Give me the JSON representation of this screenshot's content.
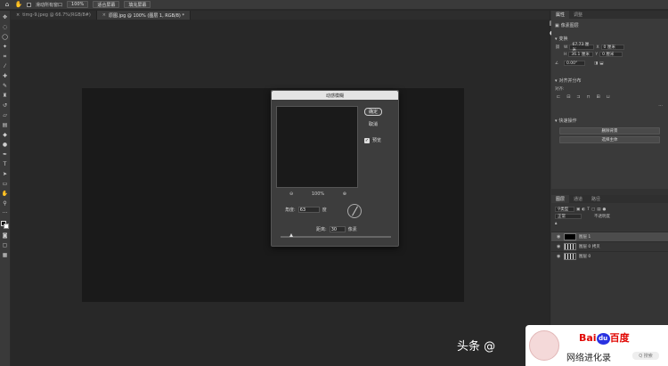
{
  "options_bar": {
    "auto_select_label": "滑动所有窗口",
    "zoom_value": "100%",
    "fit_screen_label": "适合屏幕",
    "fill_screen_label": "填充屏幕"
  },
  "tabs": [
    {
      "label": "timg-9.jpeg @ 66.7%(RGB/8#)",
      "active": false
    },
    {
      "label": "原图.jpg @ 100% (图层 1, RGB/8) *",
      "active": true
    }
  ],
  "properties_panel": {
    "tabs": [
      "属性",
      "调整"
    ],
    "pixel_layer_label": "像素图层",
    "transform_title": "变换",
    "w_label": "W",
    "w_value": "67.73 厘米",
    "x_label": "X",
    "x_value": "0 厘米",
    "h_label": "H",
    "h_value": "36.1 厘米",
    "y_label": "Y",
    "y_value": "0 厘米",
    "angle_value": "0.00°",
    "align_title": "对齐并分布",
    "align_label": "对齐:",
    "quick_actions_title": "快速操作",
    "remove_bg_label": "删除背景",
    "select_subject_label": "选择主体"
  },
  "layers_panel": {
    "tabs": [
      "图层",
      "通道",
      "路径"
    ],
    "kind_label": "类型",
    "mode_label": "正常",
    "opacity_label": "不透明度",
    "layers": [
      {
        "name": "图层 1",
        "selected": true
      },
      {
        "name": "图层 0 拷贝",
        "selected": false
      },
      {
        "name": "图层 0",
        "selected": false
      }
    ]
  },
  "motion_blur": {
    "title": "动感模糊",
    "ok_label": "确定",
    "cancel_label": "取消",
    "preview_label": "预览",
    "zoom_out": "−",
    "zoom_value": "100%",
    "zoom_in": "+",
    "angle_label": "角度:",
    "angle_value": "63",
    "angle_unit": "度",
    "distance_label": "距离:",
    "distance_value": "30",
    "distance_unit": "像素"
  },
  "watermark": {
    "source_text": "头条 @",
    "baidu_logo_text": "Bai",
    "baidu_du": "du",
    "baidu_cn": "百度",
    "account_name": "网络进化录",
    "search_label": "Q 搜索"
  },
  "colors": {
    "foreground": "#000000",
    "background": "#ffffff",
    "baidu_red": "#e10602",
    "baidu_blue": "#2932e1"
  }
}
